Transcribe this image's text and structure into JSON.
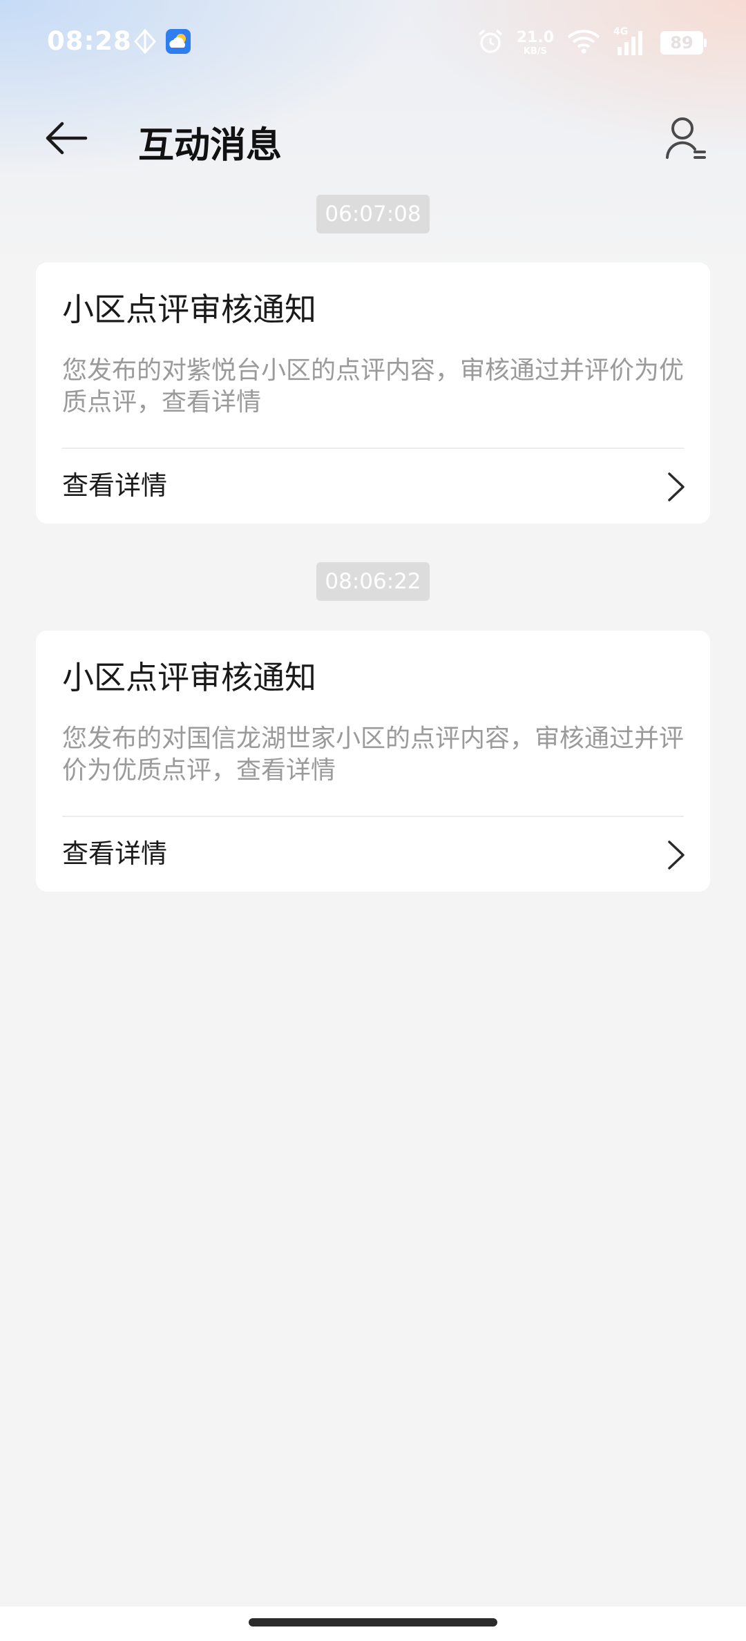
{
  "status_bar": {
    "time": "08:28",
    "net_speed_value": "21.0",
    "net_speed_unit": "KB/S",
    "network_type": "4G",
    "battery": "89"
  },
  "header": {
    "title": "互动消息"
  },
  "messages": [
    {
      "timestamp": "06:07:08",
      "title": "小区点评审核通知",
      "description": "您发布的对紫悦台小区的点评内容，审核通过并评价为优质点评，查看详情",
      "link_label": "查看详情"
    },
    {
      "timestamp": "08:06:22",
      "title": "小区点评审核通知",
      "description": "您发布的对国信龙湖世家小区的点评内容，审核通过并评价为优质点评，查看详情",
      "link_label": "查看详情"
    }
  ],
  "colors": {
    "background": "#f4f4f4",
    "card": "#ffffff",
    "timestamp_bg": "#dcdcdc",
    "description_text": "#9a9a9a"
  },
  "icons": {
    "back": "arrow-left-icon",
    "profile": "user-list-icon",
    "chevron": "chevron-right-icon"
  }
}
